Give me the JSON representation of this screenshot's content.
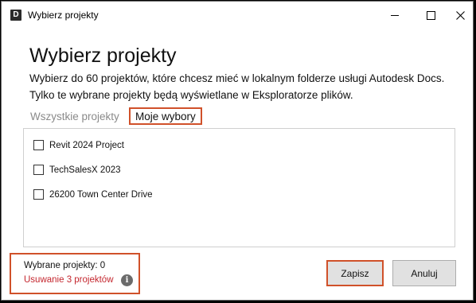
{
  "window": {
    "app_icon_letter": "D",
    "title": "Wybierz projekty"
  },
  "dialog": {
    "heading": "Wybierz projekty",
    "description_line1": "Wybierz do 60 projektów, które chcesz mieć w lokalnym folderze usługi Autodesk Docs.",
    "description_line2": "Tylko te wybrane projekty będą wyświetlane w Eksploratorze plików."
  },
  "tabs": [
    {
      "label": "Wszystkie projekty",
      "active": false
    },
    {
      "label": "Moje wybory",
      "active": true
    }
  ],
  "projects": [
    {
      "label": "Revit 2024 Project",
      "checked": false
    },
    {
      "label": "TechSalesX 2023",
      "checked": false
    },
    {
      "label": "26200 Town Center Drive",
      "checked": false
    }
  ],
  "summary": {
    "selected_text": "Wybrane projekty: 0",
    "removing_text": "Usuwanie 3 projektów",
    "removing_color": "#c4262e"
  },
  "buttons": {
    "save": "Zapisz",
    "cancel": "Anuluj"
  },
  "highlight_color": "#d0512a"
}
